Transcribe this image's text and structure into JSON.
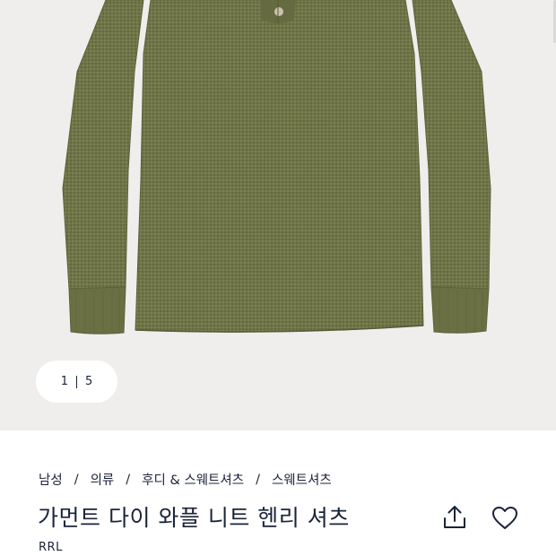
{
  "gallery": {
    "image_icon": "green-waffle-henley-shirt-image",
    "counter_current": "1",
    "counter_total": "5"
  },
  "breadcrumb": [
    "남성",
    "의류",
    "후디 & 스웨트셔츠",
    "스웨트셔츠"
  ],
  "product": {
    "title": "가먼트 다이 와플 니트 헨리 셔츠",
    "brand": "RRL"
  },
  "actions": {
    "share_icon": "share-icon",
    "favorite_icon": "heart-icon"
  },
  "colors": {
    "text": "#1a2438",
    "gallery_bg": "#efeeec",
    "shirt": "#6f7548"
  }
}
